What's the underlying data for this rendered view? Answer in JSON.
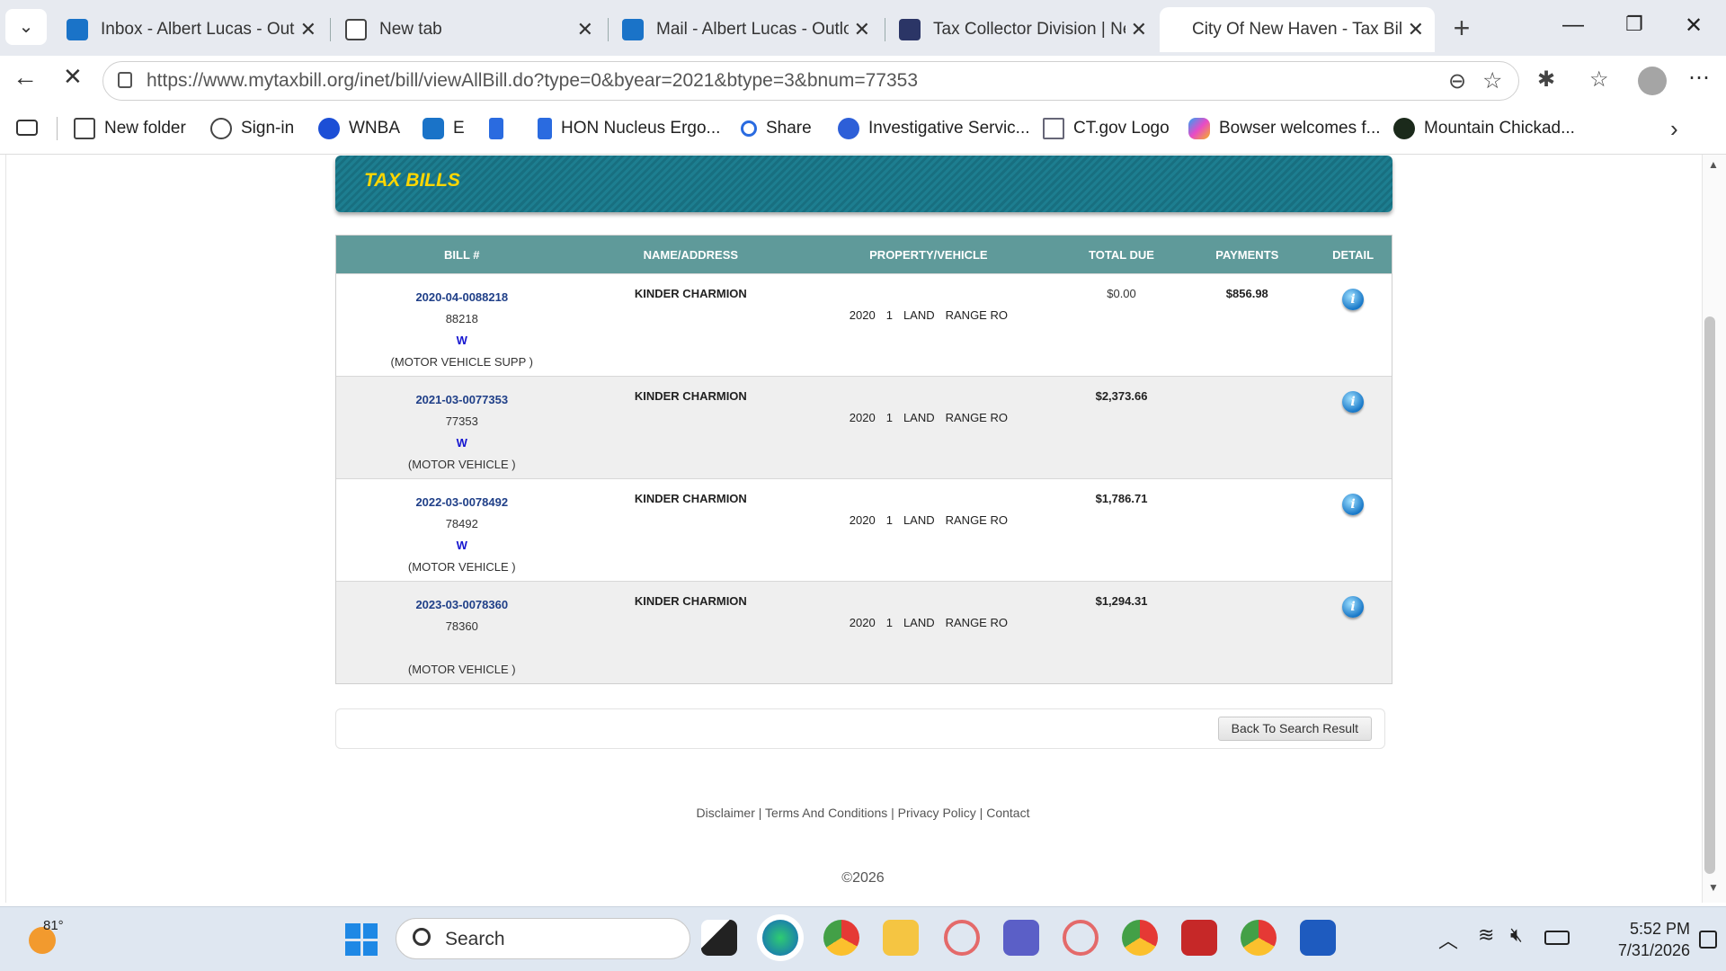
{
  "browser": {
    "tabs": [
      {
        "title": "Inbox - Albert Lucas - Outlo",
        "icon": "outlook-icon"
      },
      {
        "title": "New tab",
        "icon": "newtab-icon"
      },
      {
        "title": "Mail - Albert Lucas - Outloo",
        "icon": "outlook-icon"
      },
      {
        "title": "Tax Collector Division | New",
        "icon": "city-seal-icon"
      },
      {
        "title": "City Of New Haven - Tax Bill",
        "icon": "none",
        "active": true
      }
    ],
    "url": "https://www.mytaxbill.org/inet/bill/viewAllBill.do?type=0&byear=2021&btype=3&bnum=77353",
    "bookmarks": [
      {
        "label": "New folder",
        "icon": "folder-icon"
      },
      {
        "label": "Sign-in",
        "icon": "globe-icon"
      },
      {
        "label": "WNBA",
        "icon": "wnba-icon"
      },
      {
        "label": "E",
        "icon": "outlook-icon"
      },
      {
        "label": "",
        "icon": "bing-icon"
      },
      {
        "label": "HON Nucleus Ergo...",
        "icon": "bing-icon"
      },
      {
        "label": "Share",
        "icon": "search-icon"
      },
      {
        "label": "Investigative Servic...",
        "icon": "zoom-icon"
      },
      {
        "label": "CT.gov Logo",
        "icon": "document-icon"
      },
      {
        "label": "Bowser welcomes f...",
        "icon": "copilot-icon"
      },
      {
        "label": "Mountain Chickad...",
        "icon": "bird-icon"
      }
    ]
  },
  "page": {
    "banner_title": "TAX BILLS",
    "table": {
      "headers": [
        "BILL #",
        "NAME/ADDRESS",
        "PROPERTY/VEHICLE",
        "TOTAL DUE",
        "PAYMENTS",
        "DETAIL"
      ],
      "rows": [
        {
          "bill_no": "2020-04-0088218",
          "bill_num": "88218",
          "flag": "W",
          "type": "(MOTOR VEHICLE SUPP )",
          "name": "KINDER CHARMION",
          "year": "2020",
          "code": "1",
          "make": "LAND",
          "model": "RANGE RO",
          "total_due": "$0.00",
          "payments": "$856.98"
        },
        {
          "bill_no": "2021-03-0077353",
          "bill_num": "77353",
          "flag": "W",
          "type": "(MOTOR VEHICLE )",
          "name": "KINDER CHARMION",
          "year": "2020",
          "code": "1",
          "make": "LAND",
          "model": "RANGE RO",
          "total_due": "$2,373.66",
          "payments": ""
        },
        {
          "bill_no": "2022-03-0078492",
          "bill_num": "78492",
          "flag": "W",
          "type": "(MOTOR VEHICLE )",
          "name": "KINDER CHARMION",
          "year": "2020",
          "code": "1",
          "make": "LAND",
          "model": "RANGE RO",
          "total_due": "$1,786.71",
          "payments": ""
        },
        {
          "bill_no": "2023-03-0078360",
          "bill_num": "78360",
          "flag": "",
          "type": "(MOTOR VEHICLE )",
          "name": "KINDER CHARMION",
          "year": "2020",
          "code": "1",
          "make": "LAND",
          "model": "RANGE RO",
          "total_due": "$1,294.31",
          "payments": ""
        }
      ]
    },
    "back_button": "Back To Search Result",
    "footer_links": [
      "Disclaimer",
      "Terms And Conditions",
      "Privacy Policy",
      "Contact"
    ],
    "copyright": "©2026"
  },
  "taskbar": {
    "weather_temp": "81°",
    "search_placeholder": "Search",
    "time": "5:52 PM",
    "date": "7/31/2026"
  }
}
